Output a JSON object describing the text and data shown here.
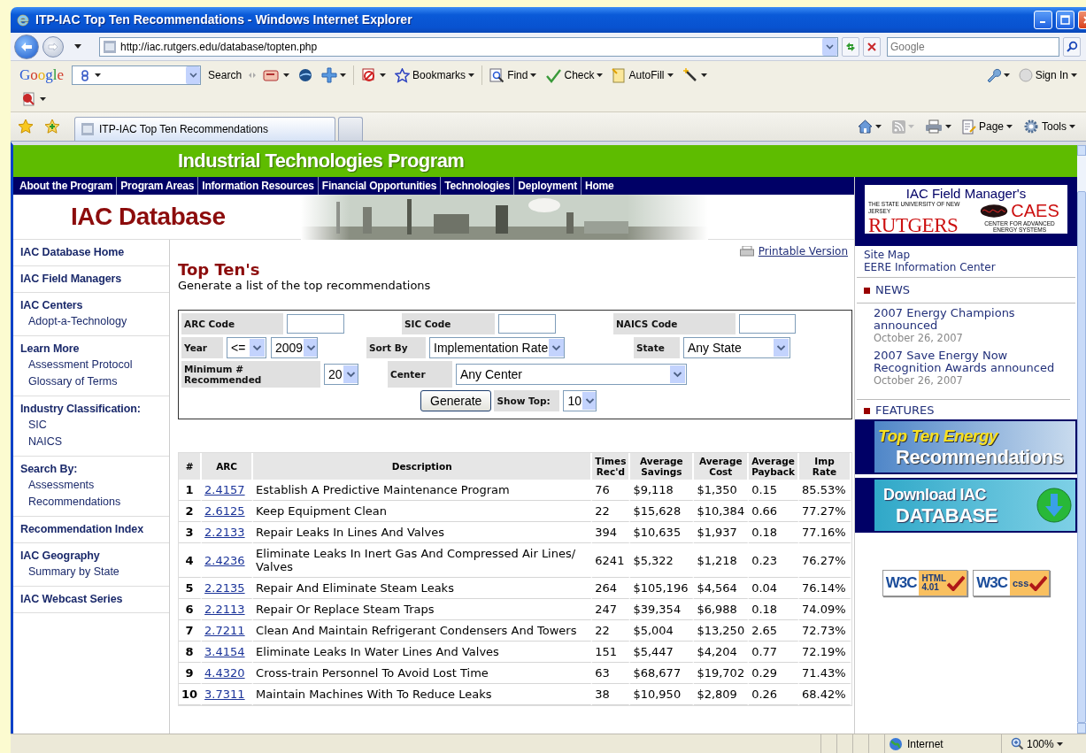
{
  "window": {
    "title": "ITP-IAC Top Ten Recommendations - Windows Internet Explorer"
  },
  "address_bar": {
    "url": "http://iac.rutgers.edu/database/topten.php"
  },
  "web_search": {
    "placeholder": "Google"
  },
  "google_toolbar": {
    "logo": "Google",
    "search": "Search",
    "bookmarks": "Bookmarks",
    "find": "Find",
    "check": "Check",
    "autofill": "AutoFill",
    "sign_in": "Sign In"
  },
  "tabs": [
    {
      "label": "ITP-IAC Top Ten Recommendations",
      "selected": true
    }
  ],
  "command_bar": {
    "page": "Page",
    "tools": "Tools"
  },
  "site": {
    "banner": "Industrial Technologies Program",
    "nav": [
      "About the Program",
      "Program Areas",
      "Information Resources",
      "Financial Opportunities",
      "Technologies",
      "Deployment",
      "Home"
    ],
    "heading": "IAC Database",
    "logo": {
      "caption": "IAC Field Manager's",
      "tagline": "THE STATE UNIVERSITY OF NEW JERSEY",
      "university": "RUTGERS",
      "center": "CAES",
      "center_tagline": "CENTER FOR ADVANCED ENERGY SYSTEMS"
    }
  },
  "sidebar": [
    {
      "title": "IAC Database Home"
    },
    {
      "title": "IAC Field Managers"
    },
    {
      "title": "IAC Centers",
      "links": [
        "Adopt-a-Technology"
      ]
    },
    {
      "title": "Learn More",
      "links": [
        "Assessment Protocol",
        "Glossary of Terms"
      ]
    },
    {
      "title": "Industry Classification:",
      "links": [
        "SIC",
        "NAICS"
      ]
    },
    {
      "title": "Search By:",
      "links": [
        "Assessments",
        "Recommendations"
      ]
    },
    {
      "title": "Recommendation Index"
    },
    {
      "title": "IAC Geography",
      "links": [
        "Summary by State"
      ]
    },
    {
      "title": "IAC Webcast Series"
    }
  ],
  "main": {
    "printable": "Printable Version",
    "title": "Top Ten's",
    "subtitle": "Generate a list of the top recommendations",
    "filters": [
      [
        {
          "kind": "field",
          "label": "ARC Code",
          "controls": [
            {
              "kind": "text"
            }
          ]
        },
        {
          "kind": "field",
          "label": "SIC Code",
          "controls": [
            {
              "kind": "text"
            }
          ]
        },
        {
          "kind": "field",
          "label": "NAICS Code",
          "controls": [
            {
              "kind": "text"
            }
          ]
        }
      ],
      [
        {
          "kind": "field",
          "label": "Year",
          "controls": [
            {
              "kind": "select",
              "value": "<="
            },
            {
              "kind": "select",
              "value": "2009"
            }
          ]
        },
        {
          "kind": "field",
          "label": "Sort By",
          "controls": [
            {
              "kind": "select",
              "value": "Implementation Rate"
            }
          ]
        },
        {
          "kind": "field",
          "label": "State",
          "controls": [
            {
              "kind": "select",
              "value": "Any State"
            }
          ]
        }
      ],
      [
        {
          "kind": "field",
          "label": "Minimum # Recommended",
          "controls": [
            {
              "kind": "select",
              "value": "20"
            }
          ]
        },
        {
          "kind": "field",
          "label": "Center",
          "controls": [
            {
              "kind": "select",
              "value": "Any Center"
            }
          ]
        }
      ],
      [
        {
          "kind": "button",
          "label": "Generate"
        },
        {
          "kind": "field",
          "label": "Show Top:",
          "controls": [
            {
              "kind": "select",
              "value": "10"
            }
          ]
        }
      ]
    ],
    "table": {
      "columns": [
        "#",
        "ARC",
        "Description",
        "Times Rec'd",
        "Average Savings",
        "Average Cost",
        "Average Payback",
        "Imp Rate"
      ],
      "rows": [
        [
          "1",
          "2.4157",
          "Establish A Predictive Maintenance Program",
          "76",
          "$9,118",
          "$1,350",
          "0.15",
          "85.53%"
        ],
        [
          "2",
          "2.6125",
          "Keep Equipment Clean",
          "22",
          "$15,628",
          "$10,384",
          "0.66",
          "77.27%"
        ],
        [
          "3",
          "2.2133",
          "Repair Leaks In Lines And Valves",
          "394",
          "$10,635",
          "$1,937",
          "0.18",
          "77.16%"
        ],
        [
          "4",
          "2.4236",
          "Eliminate Leaks In Inert Gas And Compressed Air Lines/ Valves",
          "6241",
          "$5,322",
          "$1,218",
          "0.23",
          "76.27%"
        ],
        [
          "5",
          "2.2135",
          "Repair And Eliminate Steam Leaks",
          "264",
          "$105,196",
          "$4,564",
          "0.04",
          "76.14%"
        ],
        [
          "6",
          "2.2113",
          "Repair Or Replace Steam Traps",
          "247",
          "$39,354",
          "$6,988",
          "0.18",
          "74.09%"
        ],
        [
          "7",
          "2.7211",
          "Clean And Maintain Refrigerant Condensers And Towers",
          "22",
          "$5,004",
          "$13,250",
          "2.65",
          "72.73%"
        ],
        [
          "8",
          "3.4154",
          "Eliminate Leaks In Water Lines And Valves",
          "151",
          "$5,447",
          "$4,204",
          "0.77",
          "72.19%"
        ],
        [
          "9",
          "4.4320",
          "Cross-train Personnel To Avoid Lost Time",
          "63",
          "$68,677",
          "$19,702",
          "0.29",
          "71.43%"
        ],
        [
          "10",
          "3.7311",
          "Maintain Machines With To Reduce Leaks",
          "38",
          "$10,950",
          "$2,809",
          "0.26",
          "68.42%"
        ]
      ]
    }
  },
  "right": {
    "links": [
      "Site Map",
      "EERE Information Center"
    ],
    "news": {
      "heading": "NEWS",
      "items": [
        {
          "title": "2007 Energy Champions announced",
          "date": "October 26, 2007"
        },
        {
          "title": "2007 Save Energy Now Recognition Awards announced",
          "date": "October 26, 2007"
        }
      ]
    },
    "features": {
      "heading": "FEATURES",
      "banners": [
        {
          "kind": "top_ten",
          "lines": [
            "Top Ten Energy",
            "Recommendations"
          ]
        },
        {
          "kind": "download",
          "lines": [
            "Download IAC",
            "DATABASE"
          ]
        }
      ]
    },
    "badges": [
      {
        "kind": "html",
        "logo": "W3C",
        "label": "HTML",
        "version": "4.01"
      },
      {
        "kind": "css",
        "logo": "W3C",
        "label": "css"
      }
    ]
  },
  "status_bar": {
    "zone": "Internet",
    "zoom": "100%"
  }
}
